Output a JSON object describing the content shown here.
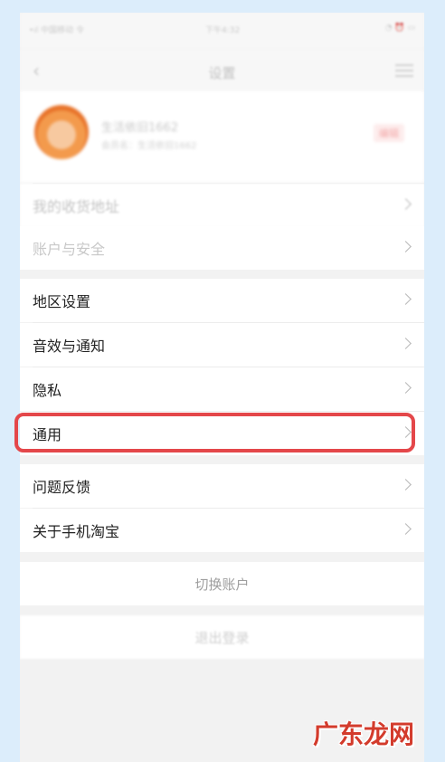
{
  "status_bar": {
    "carrier": "•ıl 中国移动 令",
    "time": "下午4:32",
    "battery": "◔ ⏰ ▭"
  },
  "nav": {
    "back_icon": "chevron-left-icon",
    "title": "设置",
    "menu_icon": "menu-icon"
  },
  "profile": {
    "name": "生活依旧1662",
    "subtitle": "会员名：生活依旧1662",
    "badge": "编辑"
  },
  "rows": {
    "address": "我的收货地址",
    "account_security": "账户与安全",
    "region": "地区设置",
    "sound": "音效与通知",
    "privacy": "隐私",
    "general": "通用",
    "feedback": "问题反馈",
    "about": "关于手机淘宝"
  },
  "buttons": {
    "switch_account": "切换账户",
    "logout": "退出登录"
  },
  "watermark": "广东龙网",
  "colors": {
    "highlight": "#e4474a",
    "background": "#dcedfb",
    "watermark": "#d33b2c"
  }
}
